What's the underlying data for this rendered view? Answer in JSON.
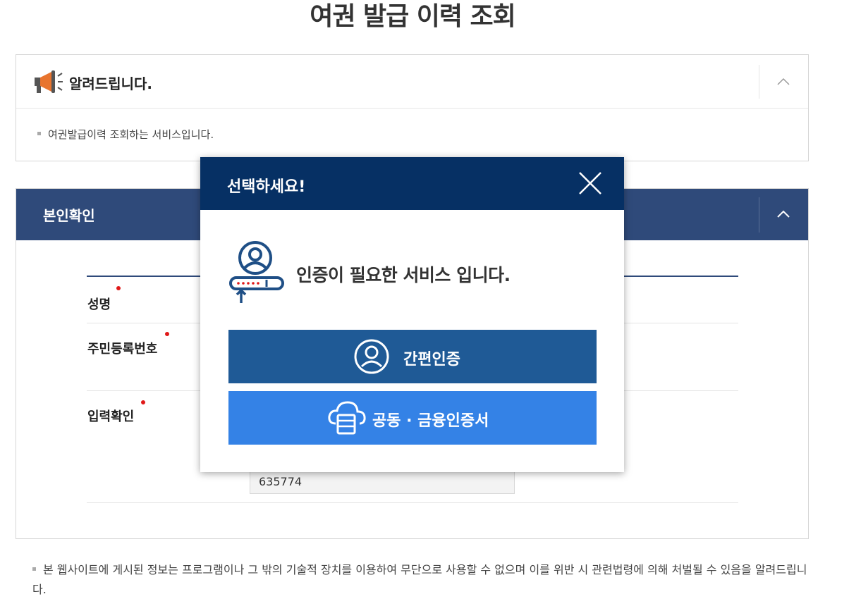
{
  "page": {
    "title": "여권 발급 이력 조회"
  },
  "notice": {
    "title": "알려드립니다.",
    "items": [
      "여권발급이력 조회하는 서비스입니다."
    ]
  },
  "identity": {
    "title": "본인확인",
    "fields": [
      {
        "label": "성명"
      },
      {
        "label": "주민등록번호"
      },
      {
        "label": "입력확인"
      }
    ],
    "captcha_value": "635774"
  },
  "footnote": "본 웹사이트에 게시된 정보는 프로그램이나 그 밖의 기술적 장치를 이용하여 무단으로 사용할 수 없으며 이를 위반 시 관련법령에 의해 처벌될 수 있음을 알려드립니다.",
  "modal": {
    "title": "선택하세요!",
    "message": "인증이 필요한 서비스 입니다.",
    "buttons": {
      "simple_auth": "간편인증",
      "cert": "공동 · 금융인증서"
    }
  },
  "colors": {
    "modal_header": "#063064",
    "section_header": "#2f4a7a",
    "simple_button": "#1f5a96",
    "cert_button": "#3482e6",
    "required_dot": "#e01818"
  },
  "icons": [
    "megaphone-icon",
    "chevron-up-icon",
    "close-icon",
    "user-auth-icon",
    "person-circle-icon",
    "cloud-server-icon"
  ]
}
